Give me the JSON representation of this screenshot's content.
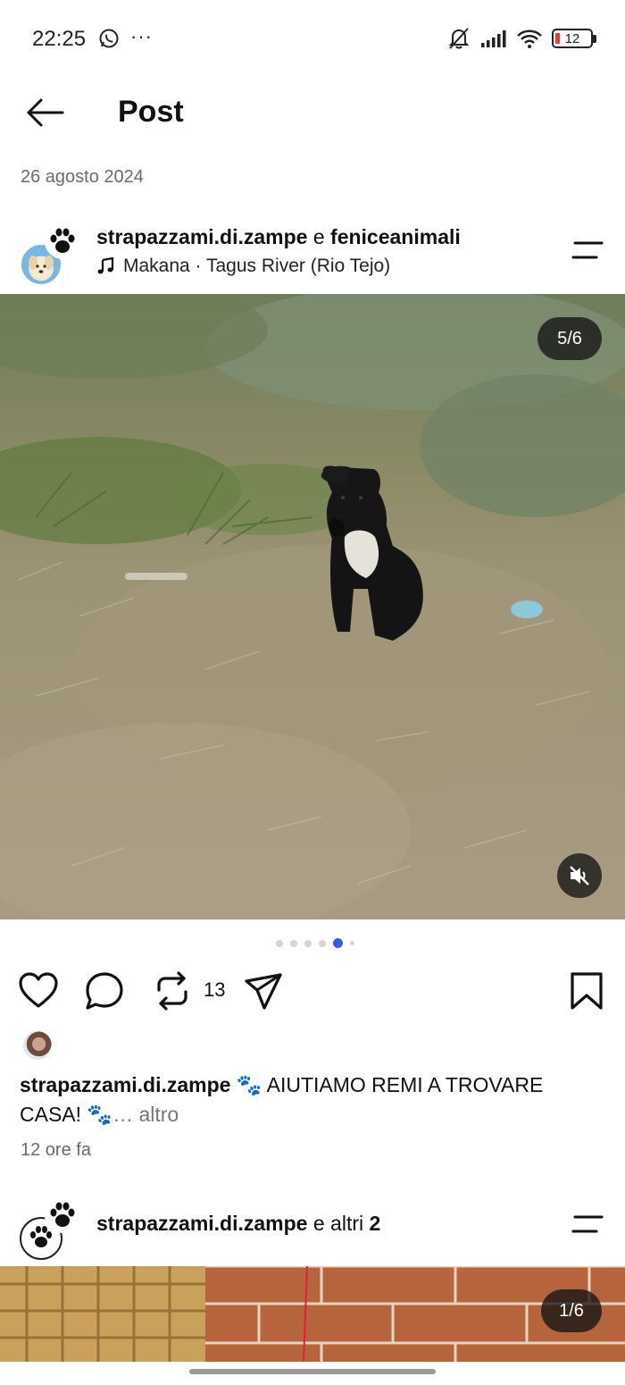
{
  "status_bar": {
    "time": "22:25",
    "more": "···",
    "battery": "12",
    "icons": [
      "whatsapp-icon",
      "muted-bell-icon",
      "signal-icon",
      "wifi-icon",
      "battery-icon"
    ]
  },
  "header": {
    "title": "Post",
    "back_icon": "arrow-left-icon"
  },
  "post": {
    "date": "26 agosto 2024",
    "user1": "strapazzami.di.zampe",
    "conj": "e",
    "user2": "feniceanimali",
    "music": "Makana · Tagus River (Rio Tejo)",
    "image_counter": "5/6",
    "carousel_total": 6,
    "carousel_active": 5,
    "repost_count": "13",
    "caption_user": "strapazzami.di.zampe",
    "caption_text": "🐾 AIUTIAMO REMI A TROVARE CASA! 🐾",
    "caption_more": "… altro",
    "time_ago": "12 ore fa"
  },
  "post2": {
    "user1": "strapazzami.di.zampe",
    "conj": "e altri",
    "others_count": "2",
    "image_counter": "1/6"
  },
  "colors": {
    "accent": "#3b5bdb",
    "battery_low": "#e53935",
    "muted_text": "#6b6b6b"
  }
}
